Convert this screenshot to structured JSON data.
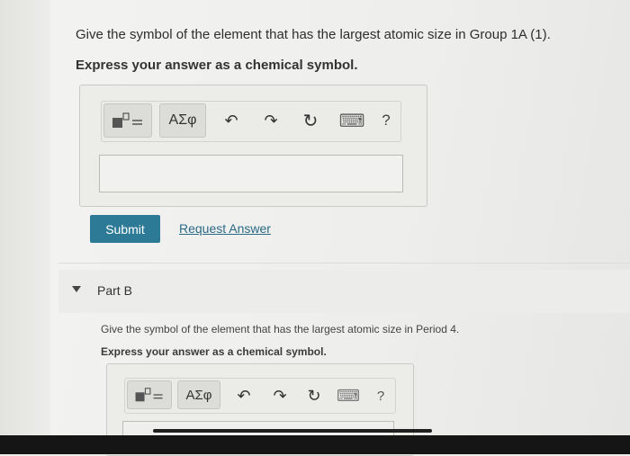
{
  "part_a": {
    "question": "Give the symbol of the element that has the largest atomic size in Group 1A (1).",
    "instruction": "Express your answer as a chemical symbol.",
    "toolbar": {
      "greek_label": "ΑΣφ",
      "undo_glyph": "↶",
      "redo_glyph": "↷",
      "reset_glyph": "↻",
      "keyboard_glyph": "⌨",
      "help_label": "?"
    },
    "answer_value": "",
    "submit_label": "Submit",
    "request_label": "Request Answer"
  },
  "part_b": {
    "title": "Part B",
    "question": "Give the symbol of the element that has the largest atomic size in Period 4.",
    "instruction": "Express your answer as a chemical symbol.",
    "toolbar": {
      "greek_label": "ΑΣφ",
      "undo_glyph": "↶",
      "redo_glyph": "↷",
      "reset_glyph": "↻",
      "keyboard_glyph": "⌨",
      "help_label": "?"
    },
    "answer_value": ""
  },
  "colors": {
    "submit_bg": "#2c7a96",
    "link": "#2a6a86"
  }
}
